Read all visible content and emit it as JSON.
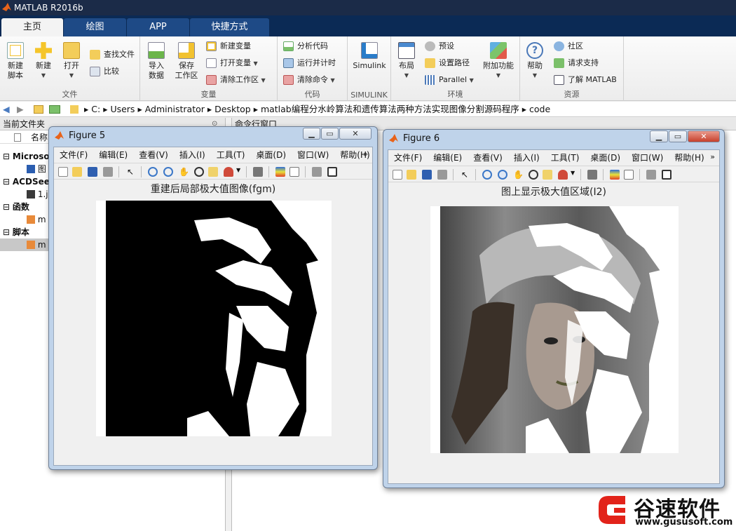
{
  "app": {
    "title": "MATLAB R2016b"
  },
  "tabs": [
    {
      "label": "主页",
      "active": true
    },
    {
      "label": "绘图"
    },
    {
      "label": "APP"
    },
    {
      "label": "快捷方式"
    }
  ],
  "ribbon": {
    "file": {
      "label": "文件",
      "new_script": "新建\n脚本",
      "new": "新建",
      "open": "打开",
      "find_files": "查找文件",
      "compare": "比较"
    },
    "variable": {
      "label": "变量",
      "import": "导入\n数据",
      "save_ws": "保存\n工作区",
      "new_var": "新建变量",
      "open_var": "打开变量",
      "clear_ws": "清除工作区"
    },
    "code": {
      "label": "代码",
      "analyze": "分析代码",
      "run_time": "运行并计时",
      "clear_cmd": "清除命令"
    },
    "simulink": {
      "label": "SIMULINK",
      "btn": "Simulink"
    },
    "env": {
      "label": "环境",
      "layout": "布局",
      "prefs": "预设",
      "set_path": "设置路径",
      "parallel": "Parallel",
      "addons": "附加功能"
    },
    "resources": {
      "label": "资源",
      "help": "帮助",
      "community": "社区",
      "support": "请求支持",
      "learn": "了解 MATLAB"
    }
  },
  "address": {
    "parts": [
      "C:",
      "Users",
      "Administrator",
      "Desktop",
      "matlab编程分水岭算法和遗传算法两种方法实现图像分割源码程序",
      "code"
    ]
  },
  "left_pane": {
    "title": "当前文件夹",
    "col_name": "名称",
    "groups": [
      {
        "label": "Microsof",
        "item": "图"
      },
      {
        "label": "ACDSee",
        "item": "1.j"
      },
      {
        "label": "函数",
        "item": "m"
      },
      {
        "label": "脚本",
        "item": "m"
      }
    ]
  },
  "cmd_pane": {
    "title": "命令行窗口"
  },
  "figure_menu": [
    "文件(F)",
    "编辑(E)",
    "查看(V)",
    "插入(I)",
    "工具(T)",
    "桌面(D)",
    "窗口(W)",
    "帮助(H)"
  ],
  "figure5": {
    "title": "Figure 5",
    "axes_title": "重建后局部极大值图像(fgm)"
  },
  "figure6": {
    "title": "Figure 6",
    "axes_title": "图上显示极大值区域(I2)"
  },
  "brand": {
    "name": "谷速软件",
    "url": "www.gususoft.com"
  },
  "colors": {
    "ribbon_tab": "#0b2a55",
    "title_bar": "#1b2b48",
    "window_frame": "#bfd3ea",
    "brand_red": "#e2231a"
  }
}
